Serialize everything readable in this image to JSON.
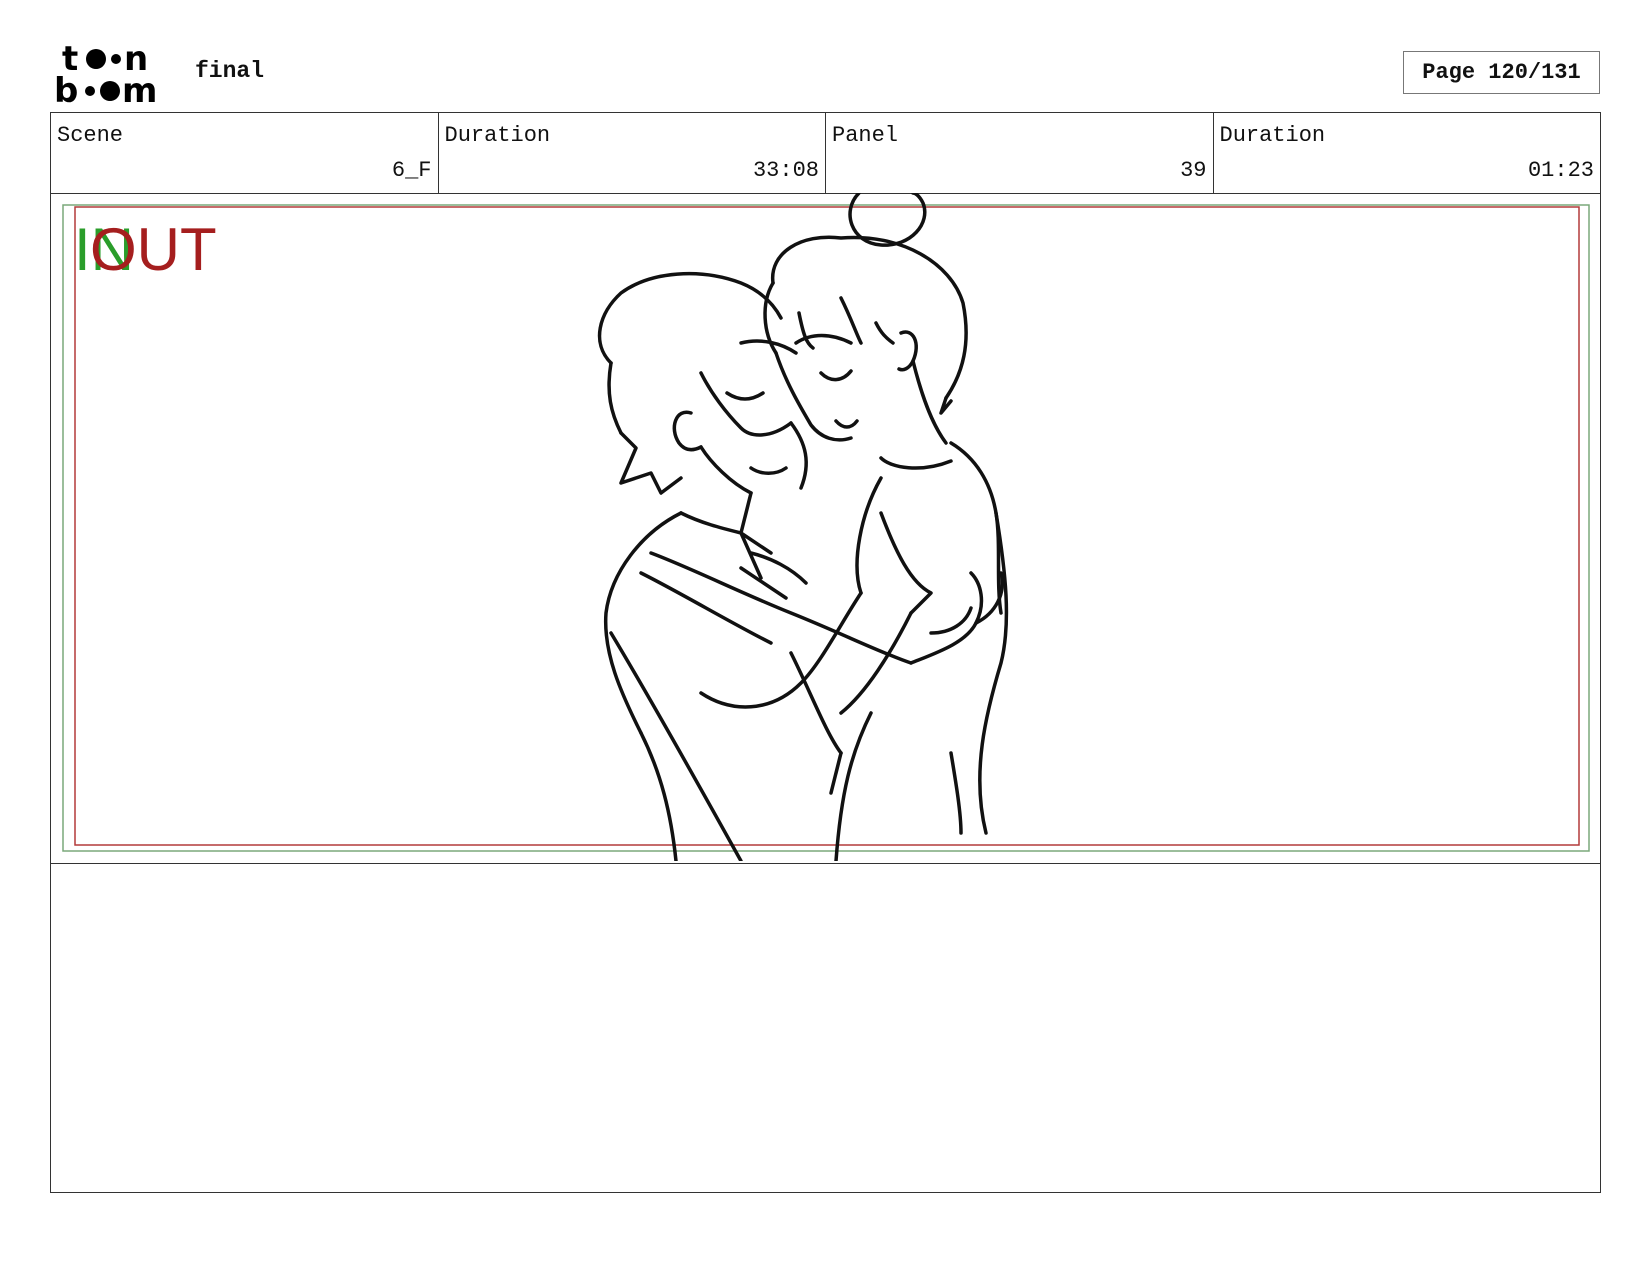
{
  "header": {
    "logo_text": "toon boom",
    "project_title": "final",
    "page_label": "Page 120/131"
  },
  "info": {
    "scene_label": "Scene",
    "scene_value": "6_F",
    "scene_duration_label": "Duration",
    "scene_duration_value": "33:08",
    "panel_label": "Panel",
    "panel_value": "39",
    "panel_duration_label": "Duration",
    "panel_duration_value": "01:23"
  },
  "frame_markers": {
    "in_label": "IN",
    "out_label": "OUT",
    "in_color": "#2a9d2a",
    "out_color": "#a51e1e"
  },
  "notes": {
    "text": ""
  }
}
